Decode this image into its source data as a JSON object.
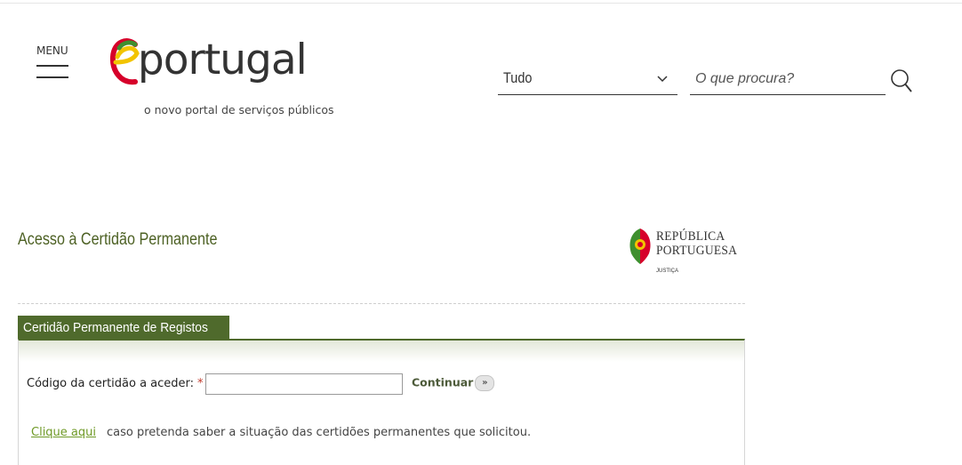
{
  "header": {
    "menu_label": "MENU",
    "logo_text": "eportugal",
    "logo_tagline": "o novo portal de serviços públicos",
    "search_scope": "Tudo",
    "search_placeholder": "O que procura?"
  },
  "main": {
    "title": "Acesso à Certidão Permanente",
    "republic_logo": {
      "line1": "REPÚBLICA",
      "line2": "PORTUGUESA",
      "small": "JUSTIÇA"
    },
    "tab_label": "Certidão Permanente de Registos",
    "code_label": "Código da certidão a aceder:",
    "required_mark": "*",
    "code_value": "",
    "continue_label": "Continuar",
    "continue_arrow": "»",
    "link_label": "Clique aqui",
    "link_text": "caso pretenda saber a situação das certidões permanentes que solicitou."
  },
  "colors": {
    "accent_green": "#4f6a2c",
    "title_green": "#4d6124",
    "link_green": "#6f9a27",
    "logo_red": "#d6002a",
    "logo_yellow": "#f2c400"
  },
  "icons": {
    "search": "search-icon",
    "dropdown": "chevron-down-icon",
    "menu": "hamburger-icon"
  }
}
